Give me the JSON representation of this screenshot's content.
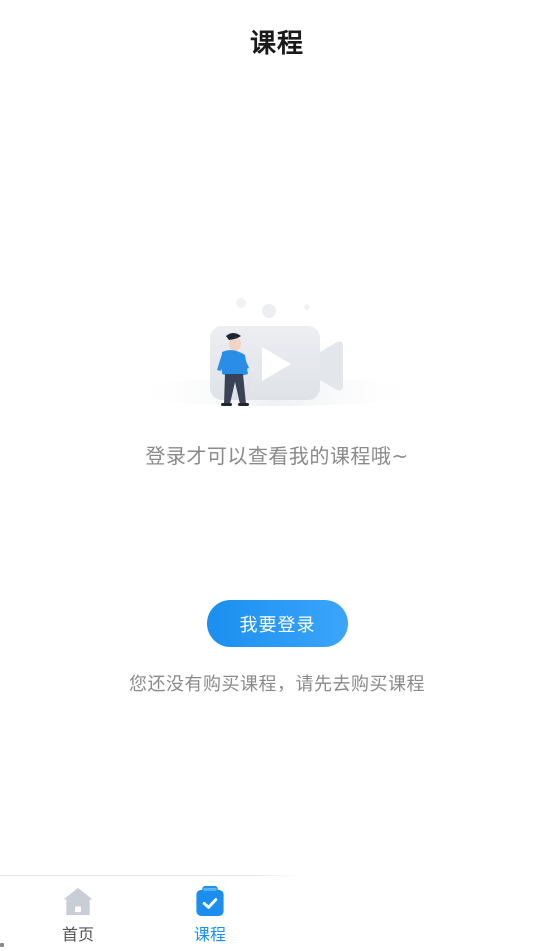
{
  "header": {
    "title": "课程"
  },
  "empty_state": {
    "illustration_icon": "video-camera-person-illustration",
    "message": "登录才可以查看我的课程哦~"
  },
  "actions": {
    "login_label": "我要登录",
    "hint": "您还没有购买课程，请先去购买课程"
  },
  "tabbar": {
    "tabs": [
      {
        "label": "首页",
        "icon": "home-icon",
        "active": false
      },
      {
        "label": "课程",
        "icon": "course-clipboard-icon",
        "active": true
      }
    ]
  },
  "colors": {
    "accent": "#1a8fef",
    "inactive": "#c8cdd6",
    "text_gray": "#8a8a8a",
    "title": "#1a1a1a"
  }
}
